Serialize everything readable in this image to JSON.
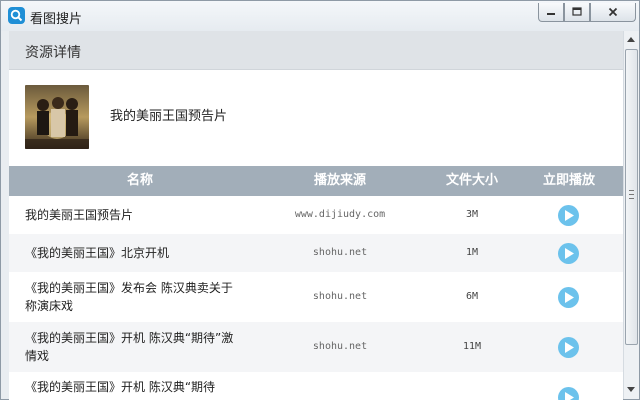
{
  "window": {
    "title": "看图搜片",
    "controls": {
      "minimize_icon": "minimize-icon",
      "maximize_icon": "maximize-icon",
      "close_icon": "close-icon"
    }
  },
  "detail": {
    "section_title": "资源详情",
    "resource_name": "我的美丽王国预告片",
    "poster_icon": "movie-poster-image"
  },
  "table": {
    "headers": {
      "name": "名称",
      "source": "播放来源",
      "size": "文件大小",
      "play": "立即播放"
    },
    "rows": [
      {
        "name": "我的美丽王国预告片",
        "source": "www.dijiudy.com",
        "size": "3M"
      },
      {
        "name": "《我的美丽王国》北京开机",
        "source": "shohu.net",
        "size": "1M"
      },
      {
        "name": "《我的美丽王国》发布会 陈汉典卖关于称演床戏",
        "source": "shohu.net",
        "size": "6M"
      },
      {
        "name": "《我的美丽王国》开机 陈汉典“期待”激情戏",
        "source": "shohu.net",
        "size": "11M"
      },
      {
        "name": "《我的美丽王国》开机 陈汉典“期待",
        "source": "",
        "size": ""
      }
    ]
  },
  "colors": {
    "header_bg": "#a2aeb9",
    "section_bg": "#dfe3e7",
    "play_button": "#6cc2ec",
    "app_icon": "#1f8fd6"
  }
}
